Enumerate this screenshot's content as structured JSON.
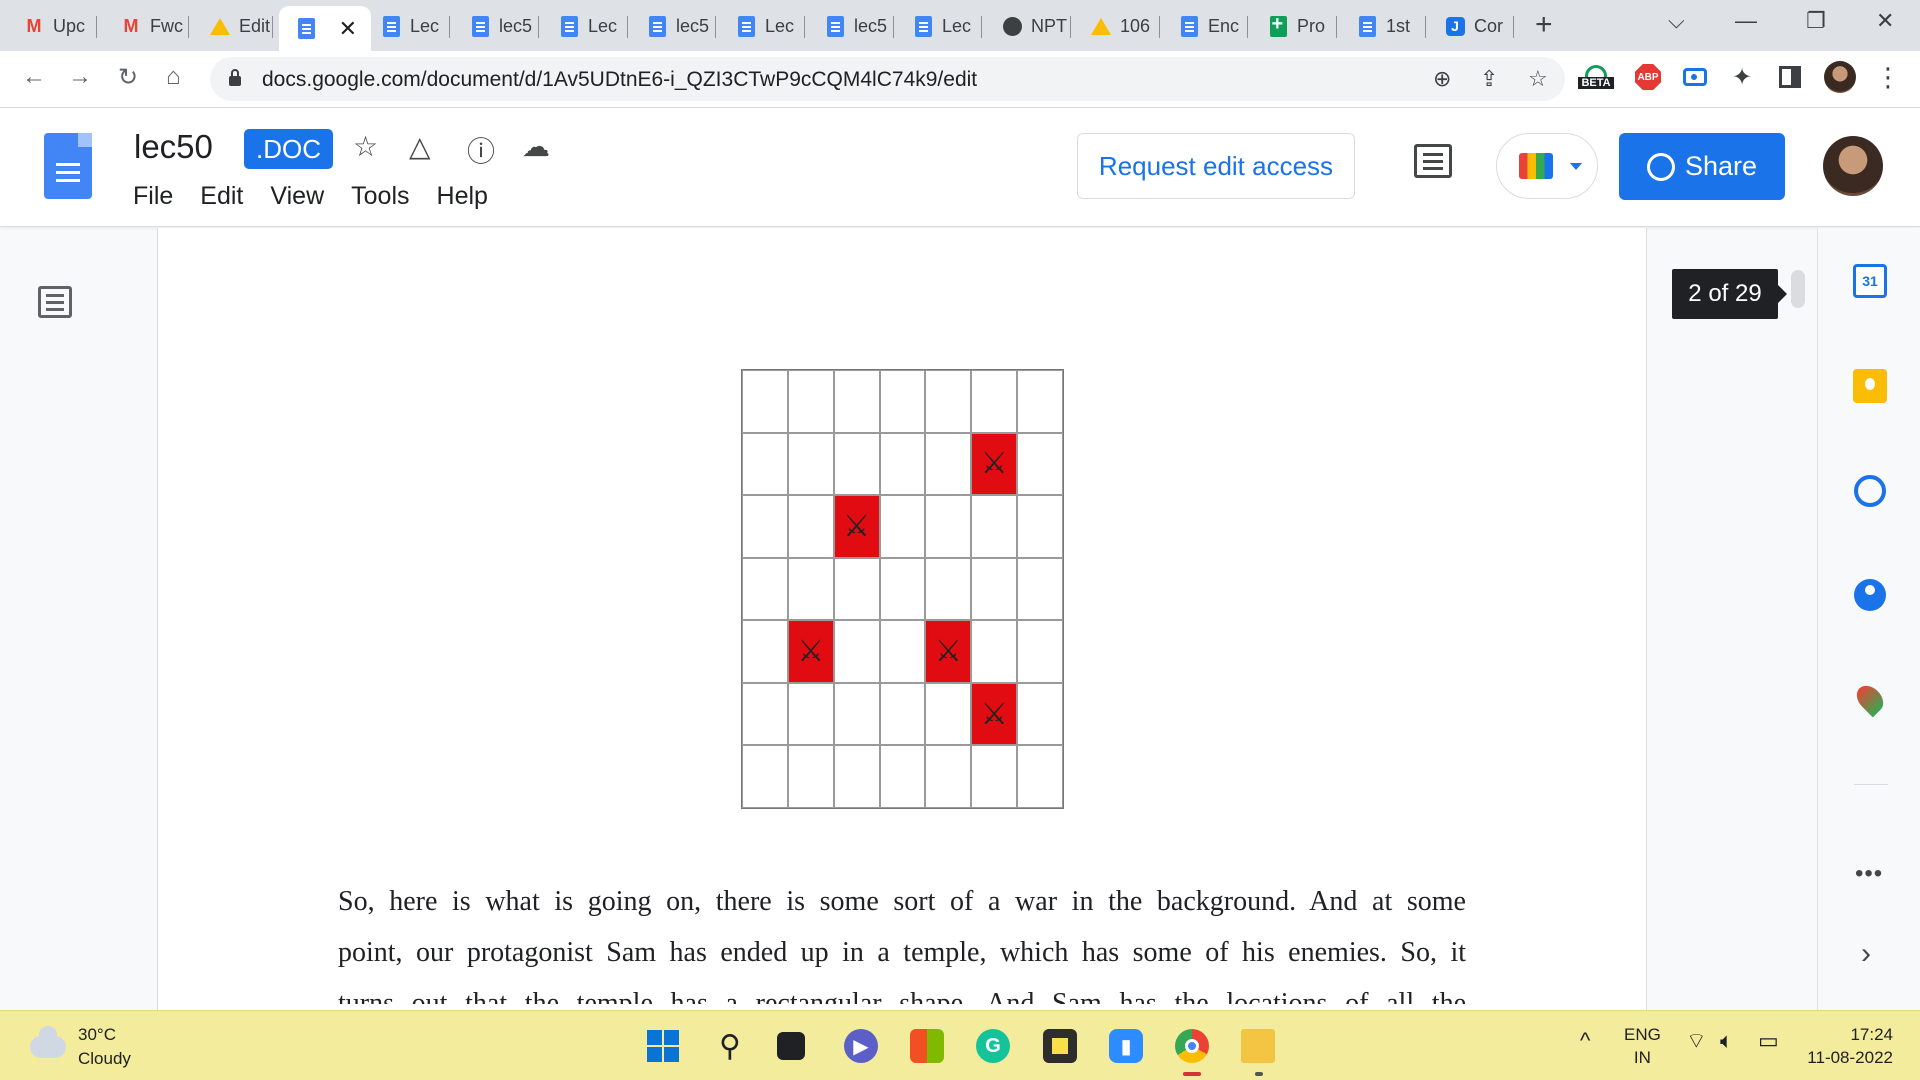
{
  "browser": {
    "tabs": [
      {
        "label": "Upc",
        "icon": "gmail-icon"
      },
      {
        "label": "Fwc",
        "icon": "gmail-icon"
      },
      {
        "label": "Edit",
        "icon": "drive-icon"
      },
      {
        "label": "",
        "icon": "docs-icon",
        "active": true
      },
      {
        "label": "Lec",
        "icon": "docs-icon"
      },
      {
        "label": "lec5",
        "icon": "docs-icon"
      },
      {
        "label": "Lec",
        "icon": "docs-icon"
      },
      {
        "label": "lec5",
        "icon": "docs-icon"
      },
      {
        "label": "Lec",
        "icon": "docs-icon"
      },
      {
        "label": "lec5",
        "icon": "docs-icon"
      },
      {
        "label": "Lec",
        "icon": "docs-icon"
      },
      {
        "label": "NPT",
        "icon": "globe-icon"
      },
      {
        "label": "106",
        "icon": "drive-icon"
      },
      {
        "label": "Enc",
        "icon": "docs-icon"
      },
      {
        "label": "Pro",
        "icon": "sheets-icon"
      },
      {
        "label": "1st",
        "icon": "docs-icon"
      },
      {
        "label": "Cor",
        "icon": "j-icon"
      }
    ],
    "close_tab_glyph": "✕",
    "new_tab_glyph": "+",
    "url": "docs.google.com/document/d/1Av5UDtnE6-i_QZI3CTwP9cCQM4lC74k9/edit",
    "beta_badge": "BETA",
    "abp_badge": "ABP"
  },
  "docs": {
    "title": ".lec50",
    "title_text": "lec50",
    "badge": ".DOC",
    "menu": [
      "File",
      "Edit",
      "View",
      "Tools",
      "Help"
    ],
    "request_edit_access": "Request edit access",
    "share": "Share",
    "page_indicator": "2 of 29",
    "calendar_day": "31"
  },
  "grid": {
    "rows": 7,
    "cols": 7,
    "enemy_glyph": "⚔",
    "enemy_color": "#e00c12",
    "enemies": [
      [
        1,
        5
      ],
      [
        2,
        2
      ],
      [
        4,
        1
      ],
      [
        4,
        4
      ],
      [
        5,
        5
      ]
    ]
  },
  "body_text": {
    "line1": "So, here is what is going on, there is some sort of a war in the background. And at some",
    "line2": "point, our protagonist Sam has ended up in a temple, which has some of his enemies. So, it",
    "line3": "turns out that the temple has a rectangular shape. And Sam has the locations of all the"
  },
  "taskbar": {
    "temperature": "30°C",
    "condition": "Cloudy",
    "language": "ENG",
    "region": "IN",
    "time": "17:24",
    "date": "11-08-2022"
  },
  "colors": {
    "accent": "#1a73e8",
    "taskbar": "#f3ec9d"
  }
}
